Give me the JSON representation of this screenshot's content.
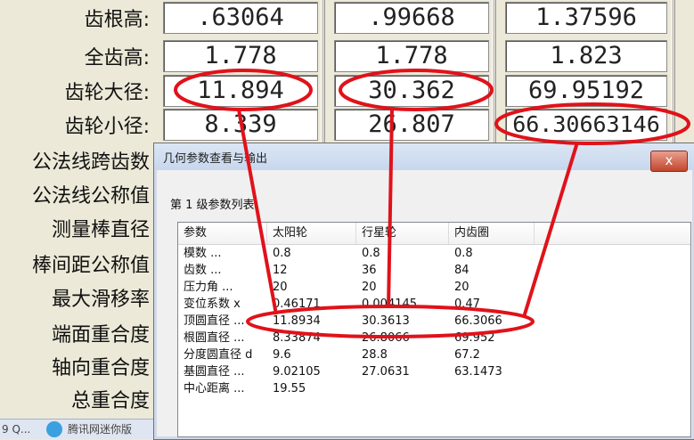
{
  "labels": [
    "齿根高:",
    "全齿高:",
    "齿轮大径:",
    "齿轮小径:",
    "公法线跨齿数",
    "公法线公称值",
    "测量棒直径",
    "棒间距公称值",
    "最大滑移率",
    "端面重合度",
    "轴向重合度",
    "总重合度"
  ],
  "fields": {
    "tooth_root_height": [
      ".63064",
      ".99668",
      "1.37596"
    ],
    "full_tooth_height": [
      "1.778",
      "1.778",
      "1.823"
    ],
    "major_diameter": [
      "11.894",
      "30.362",
      "69.95192"
    ],
    "minor_diameter": [
      "8.339",
      "26.807",
      "66.30663146"
    ]
  },
  "taskbar": {
    "item1": "9 Q...",
    "item2": "腾讯网迷你版"
  },
  "dialog": {
    "title": "几何参数查看与输出",
    "close_label": "x",
    "level_label": "第 1 级参数列表",
    "columns": [
      "参数",
      "太阳轮",
      "行星轮",
      "内齿圈"
    ],
    "rows": [
      [
        "模数    ...",
        "0.8",
        "0.8",
        "0.8"
      ],
      [
        "齿数    ...",
        "12",
        "36",
        "84"
      ],
      [
        "压力角  ...",
        "20",
        "20",
        "20"
      ],
      [
        "变位系数   x",
        "0.46171",
        "0.004145",
        "0.47"
      ],
      [
        "顶圆直径  ...",
        "11.8934",
        "30.3613",
        "66.3066"
      ],
      [
        "根圆直径 ...",
        "8.33874",
        "26.8066",
        "69.952"
      ],
      [
        "分度圆直径 d",
        "9.6",
        "28.8",
        "67.2"
      ],
      [
        "基圆直径 ...",
        "9.02105",
        "27.0631",
        "63.1473"
      ],
      [
        "中心距离 ...",
        "19.55",
        "",
        ""
      ]
    ]
  },
  "colors": {
    "annotation": "#e0121a",
    "bg": "#ece9d8"
  }
}
